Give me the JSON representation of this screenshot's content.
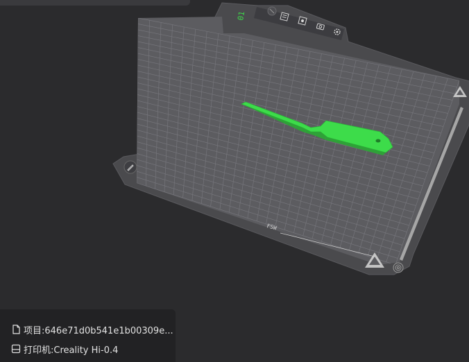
{
  "project": {
    "label": "项目:646e71d0b541e1b00309e..."
  },
  "printer": {
    "label": "打印机:Creality Hi-0.4"
  },
  "bed": {
    "plate_number": "01",
    "bed_label": "FSW",
    "grid": true,
    "model_color": "#3ddc4a"
  },
  "plate_toolbar": {
    "icons": [
      "arrange-icon",
      "auto-layout-icon",
      "camera-icon",
      "settings-icon"
    ]
  },
  "icons": {
    "edit": "edit-plate-icon",
    "project": "file-icon",
    "printer": "printer-icon"
  }
}
